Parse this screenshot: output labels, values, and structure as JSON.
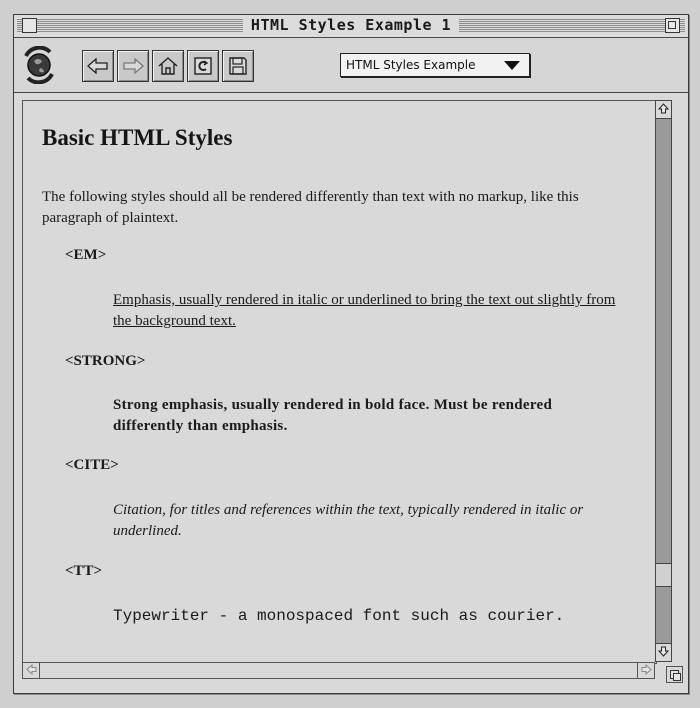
{
  "window": {
    "title": "HTML Styles Example 1"
  },
  "toolbar": {
    "buttons": [
      "back-icon",
      "forward-icon",
      "home-icon",
      "reload-icon",
      "save-icon"
    ],
    "history_select": "HTML Styles Example"
  },
  "page": {
    "heading": "Basic HTML Styles",
    "intro": "The following styles should all be rendered differently than text with no markup, like this paragraph of plaintext.",
    "items": [
      {
        "tag": "<EM>",
        "text": "Emphasis, usually rendered in italic or underlined to bring the text out slightly from the background text."
      },
      {
        "tag": "<STRONG>",
        "text": "Strong emphasis, usually rendered in bold face. Must be rendered differently than emphasis."
      },
      {
        "tag": "<CITE>",
        "text": "Citation, for titles and references within the text, typically rendered in italic or underlined."
      },
      {
        "tag": "<TT>",
        "text": "Typewriter - a monospaced font such as courier."
      }
    ]
  },
  "colors": {
    "window_bg": "#d9d9d9",
    "scroll_track": "#9a9a9a"
  }
}
